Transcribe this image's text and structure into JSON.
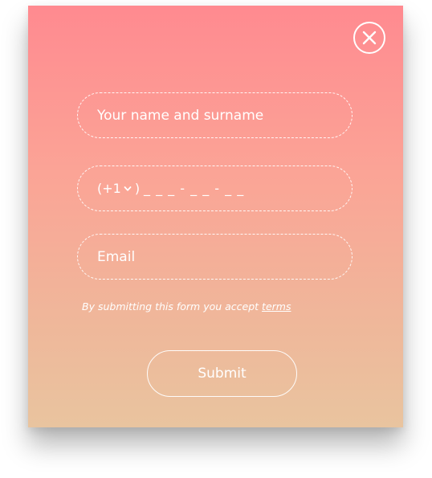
{
  "form": {
    "name_placeholder": "Your name and surname",
    "phone": {
      "country_code": "(+1",
      "closing_paren": ")",
      "mask": "_ _ _ - _ _ - _ _"
    },
    "email_placeholder": "Email",
    "terms_prefix": "By submitting this form you accept ",
    "terms_link": "terms",
    "submit_label": "Submit"
  },
  "icons": {
    "close": "close-icon",
    "dropdown": "chevron-down-icon"
  },
  "colors": {
    "gradient_top": "#ff8a90",
    "gradient_bottom": "#e9c49f",
    "foreground": "#ffffff"
  }
}
